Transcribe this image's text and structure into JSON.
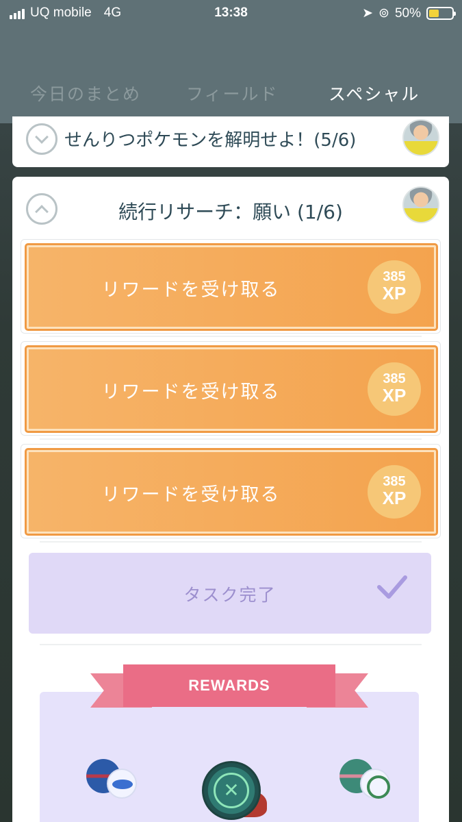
{
  "status_bar": {
    "carrier": "UQ mobile",
    "network": "4G",
    "time": "13:38",
    "battery": "50%",
    "battery_level": 0.5
  },
  "tabs": [
    {
      "label": "今日のまとめ",
      "active": false
    },
    {
      "label": "フィールド",
      "active": false
    },
    {
      "label": "スペシャル",
      "active": true
    }
  ],
  "research_collapsed": {
    "title": "せんりつポケモンを解明せよ！(5/6)"
  },
  "research_open": {
    "title": "続行リサーチ：願い (1/6)",
    "tasks": [
      {
        "label": "リワードを受け取る",
        "xp_amount": "385",
        "xp_unit": "XP"
      },
      {
        "label": "リワードを受け取る",
        "xp_amount": "385",
        "xp_unit": "XP"
      },
      {
        "label": "リワードを受け取る",
        "xp_amount": "385",
        "xp_unit": "XP"
      }
    ],
    "completed_task": {
      "label": "タスク完了"
    },
    "rewards_banner": "REWARDS"
  },
  "colors": {
    "header_bg": "#5f7176",
    "reward_button": "#f4a34e",
    "task_complete_bg": "#e0d9f7",
    "rewards_ribbon": "#ea6d86",
    "close_button": "#2f7a72"
  }
}
